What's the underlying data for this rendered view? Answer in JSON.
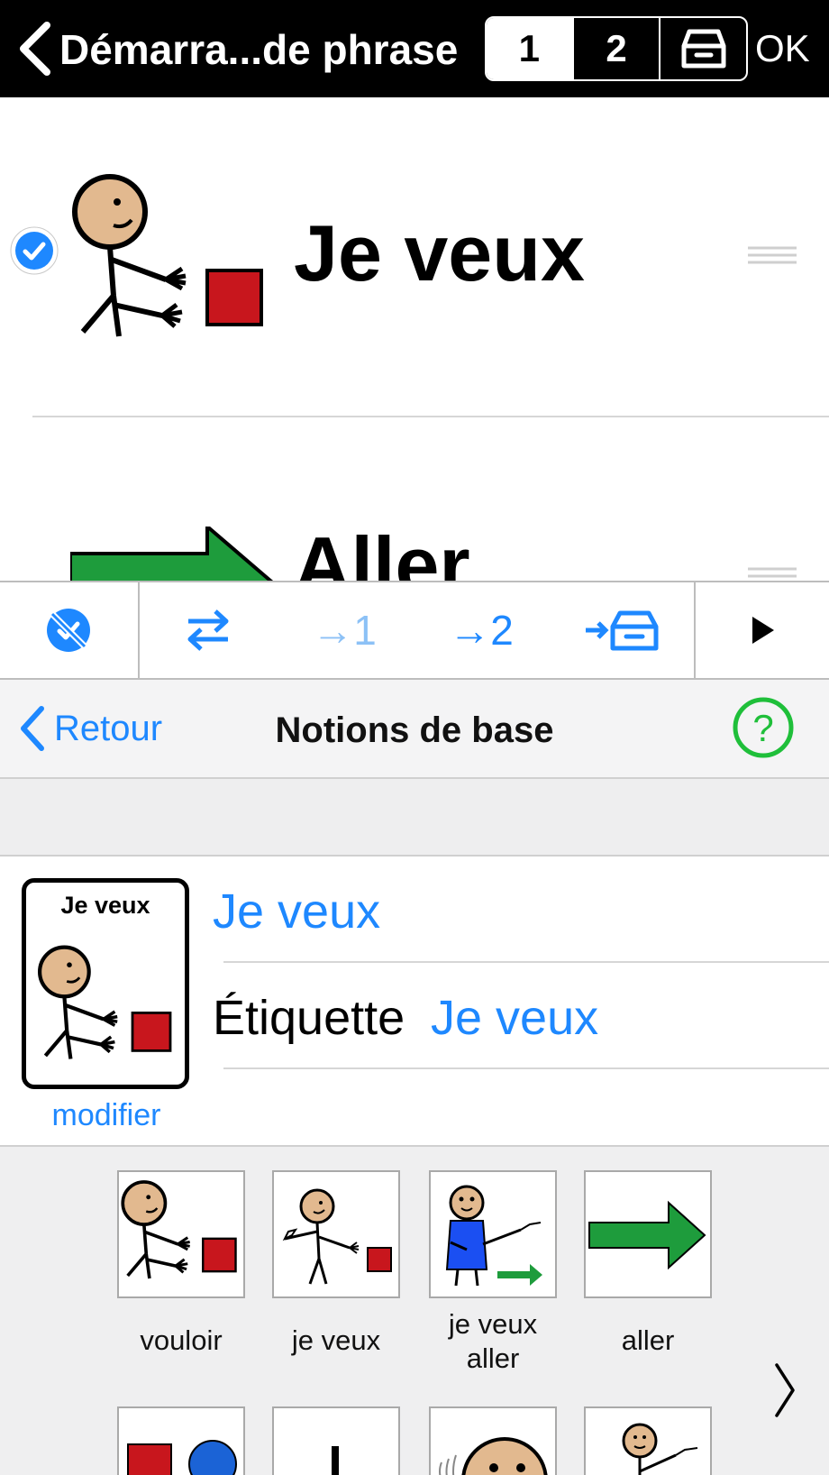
{
  "topbar": {
    "title": "Démarra...de phrase",
    "segments": [
      "1",
      "2"
    ],
    "ok_label": "OK"
  },
  "list": {
    "rows": [
      {
        "label": "Je veux",
        "selected": true
      },
      {
        "label": "Aller",
        "selected": false
      }
    ]
  },
  "toolbar": {
    "items": [
      {
        "name": "hide-icon"
      },
      {
        "name": "swap-icon"
      },
      {
        "label": "→1"
      },
      {
        "label": "→2"
      },
      {
        "name": "move-to-archive-icon"
      },
      {
        "name": "play-icon"
      }
    ]
  },
  "nav": {
    "back_label": "Retour",
    "title": "Notions de base"
  },
  "details": {
    "card_title": "Je veux",
    "modify_label": "modifier",
    "word": "Je veux",
    "label_key": "Étiquette",
    "label_value": "Je veux"
  },
  "suggestions": {
    "items": [
      {
        "label": "vouloir"
      },
      {
        "label": "je veux"
      },
      {
        "label": "je veux aller"
      },
      {
        "label": "aller"
      }
    ]
  },
  "colors": {
    "accent": "#1e88ff",
    "help_green": "#1fbf3a",
    "symbol_red": "#c8161d",
    "symbol_green": "#1e9c3c",
    "skin": "#e2b98f"
  }
}
